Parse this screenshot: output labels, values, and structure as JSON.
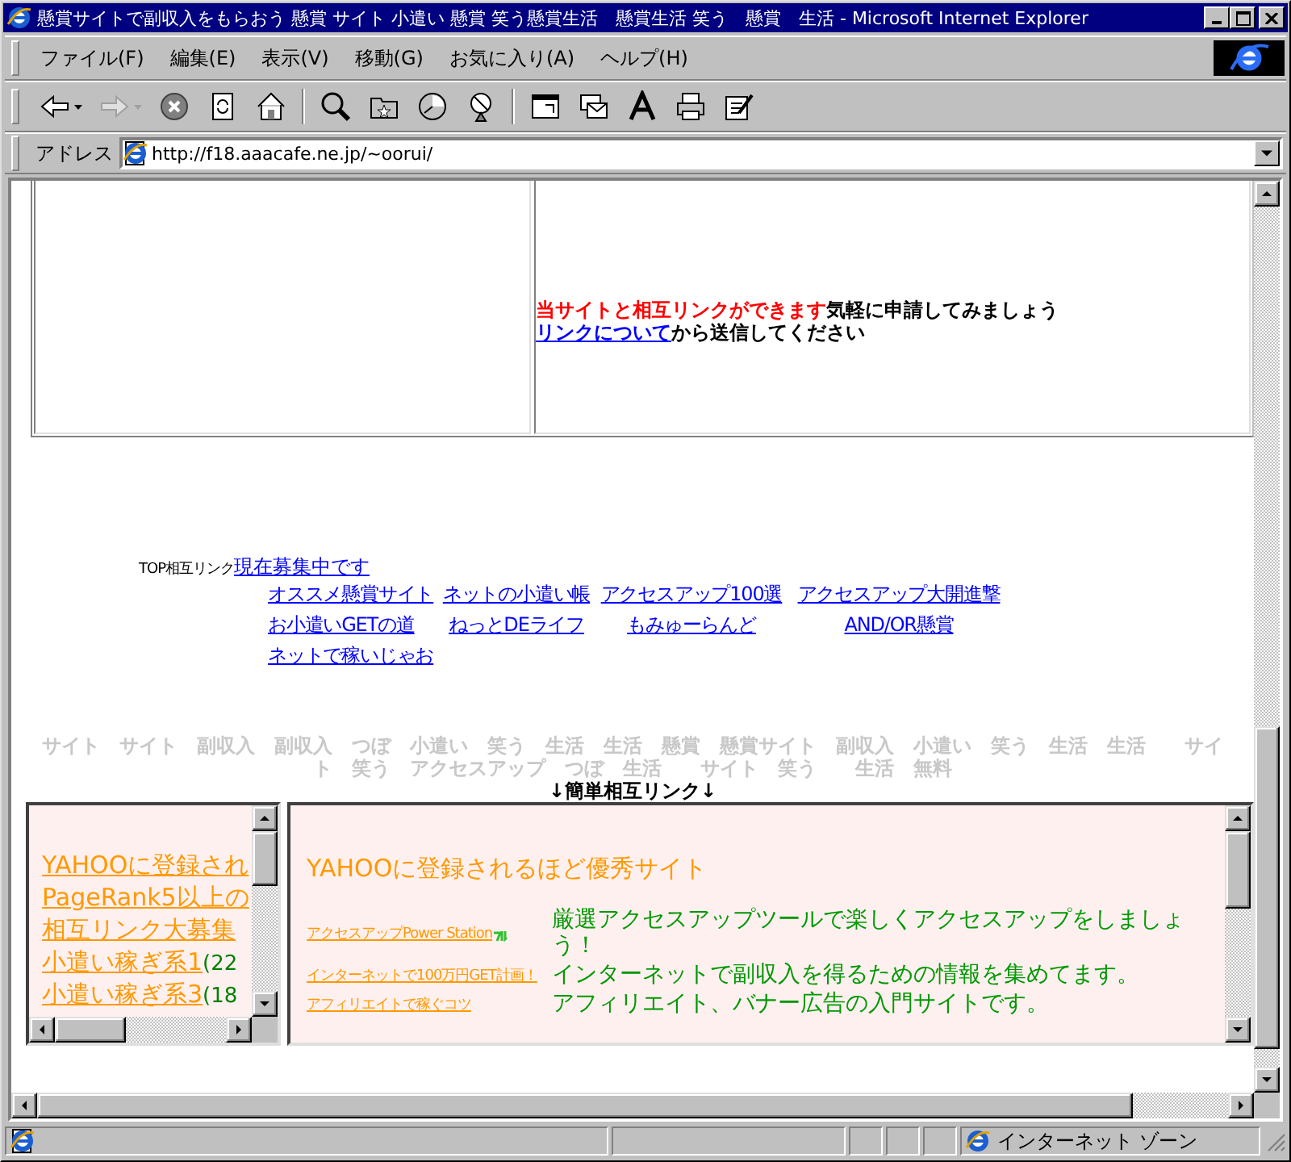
{
  "window": {
    "title": "懸賞サイトで副収入をもらおう 懸賞 サイト 小遣い 懸賞 笑う懸賞生活　懸賞生活 笑う　懸賞　生活 - Microsoft Internet Explorer"
  },
  "menu": [
    {
      "label": "ファイル(F)"
    },
    {
      "label": "編集(E)"
    },
    {
      "label": "表示(V)"
    },
    {
      "label": "移動(G)"
    },
    {
      "label": "お気に入り(A)"
    },
    {
      "label": "ヘルプ(H)"
    }
  ],
  "toolbar": [
    {
      "kind": "back",
      "disabled": false,
      "dropdown": true
    },
    {
      "kind": "forward",
      "disabled": true,
      "dropdown": true
    },
    {
      "kind": "stop",
      "disabled": false,
      "dropdown": false
    },
    {
      "kind": "refresh",
      "disabled": false,
      "dropdown": false
    },
    {
      "kind": "home",
      "disabled": false,
      "dropdown": false
    },
    {
      "kind": "separator",
      "disabled": false,
      "dropdown": false
    },
    {
      "kind": "search",
      "disabled": false,
      "dropdown": false
    },
    {
      "kind": "favorites",
      "disabled": false,
      "dropdown": false
    },
    {
      "kind": "history",
      "disabled": false,
      "dropdown": false
    },
    {
      "kind": "channels",
      "disabled": false,
      "dropdown": false
    },
    {
      "kind": "separator",
      "disabled": false,
      "dropdown": false
    },
    {
      "kind": "fullscreen",
      "disabled": false,
      "dropdown": false
    },
    {
      "kind": "mail",
      "disabled": false,
      "dropdown": false
    },
    {
      "kind": "font",
      "disabled": false,
      "dropdown": false
    },
    {
      "kind": "print",
      "disabled": false,
      "dropdown": false
    },
    {
      "kind": "edit",
      "disabled": false,
      "dropdown": false
    }
  ],
  "address": {
    "label": "アドレス",
    "value": "http://f18.aaacafe.ne.jp/~oorui/"
  },
  "notice": {
    "parts": [
      {
        "kind": "highlight",
        "text": "当サイトと相互リンクができます"
      },
      {
        "kind": "plain",
        "text": "気軽に申請してみましょう"
      }
    ],
    "link": "リンクについて",
    "link_rest": "から送信してください"
  },
  "top_link": {
    "label": "TOP相互リンク",
    "link": "現在募集中です"
  },
  "link_grid": [
    [
      "オススメ懸賞サイト",
      "ネットの小遣い帳",
      "アクセスアップ100選",
      "アクセスアップ大開進撃"
    ],
    [
      "お小遣いGETの道",
      "ねっとDEライフ",
      "もみゅーらんど",
      "AND/OR懸賞"
    ],
    [
      "ネットで稼いじゃお"
    ]
  ],
  "keywords": [
    "サイト　サイト　副収入　副収入　つぼ　小遣い　笑う　生活　生活　懸賞　懸賞サイト　副収入　小遣い　笑う　生活　生活　　サイ",
    "ト　笑う　アクセスアップ　つぼ　生活　　サイト　笑う　　生活　無料"
  ],
  "simple_links_title": "↓簡単相互リンク↓",
  "left_frame": {
    "items": [
      {
        "text": "YAHOOに登録され"
      },
      {
        "text": "PageRank5以上の"
      },
      {
        "text": "相互リンク大募集"
      },
      {
        "text": "小遣い稼ぎ系1",
        "count": "(22"
      },
      {
        "text": "小遣い稼ぎ系3",
        "count": "(18"
      }
    ]
  },
  "right_frame": {
    "heading": "YAHOOに登録されるほど優秀サイト",
    "entries": [
      {
        "link": "アクセスアップPower Station",
        "new": true,
        "desc": "厳選アクセスアップツールで楽しくアクセスアップをしましょう！"
      },
      {
        "link": "インターネットで100万円GET計画！",
        "new": false,
        "desc": "インターネットで副収入を得るための情報を集めてます。"
      },
      {
        "link": "アフィリエイトで稼ぐコツ",
        "new": false,
        "desc": "アフィリエイト、バナー広告の入門サイトです。"
      }
    ]
  },
  "status_bar": {
    "zone": "インターネット ゾーン"
  }
}
